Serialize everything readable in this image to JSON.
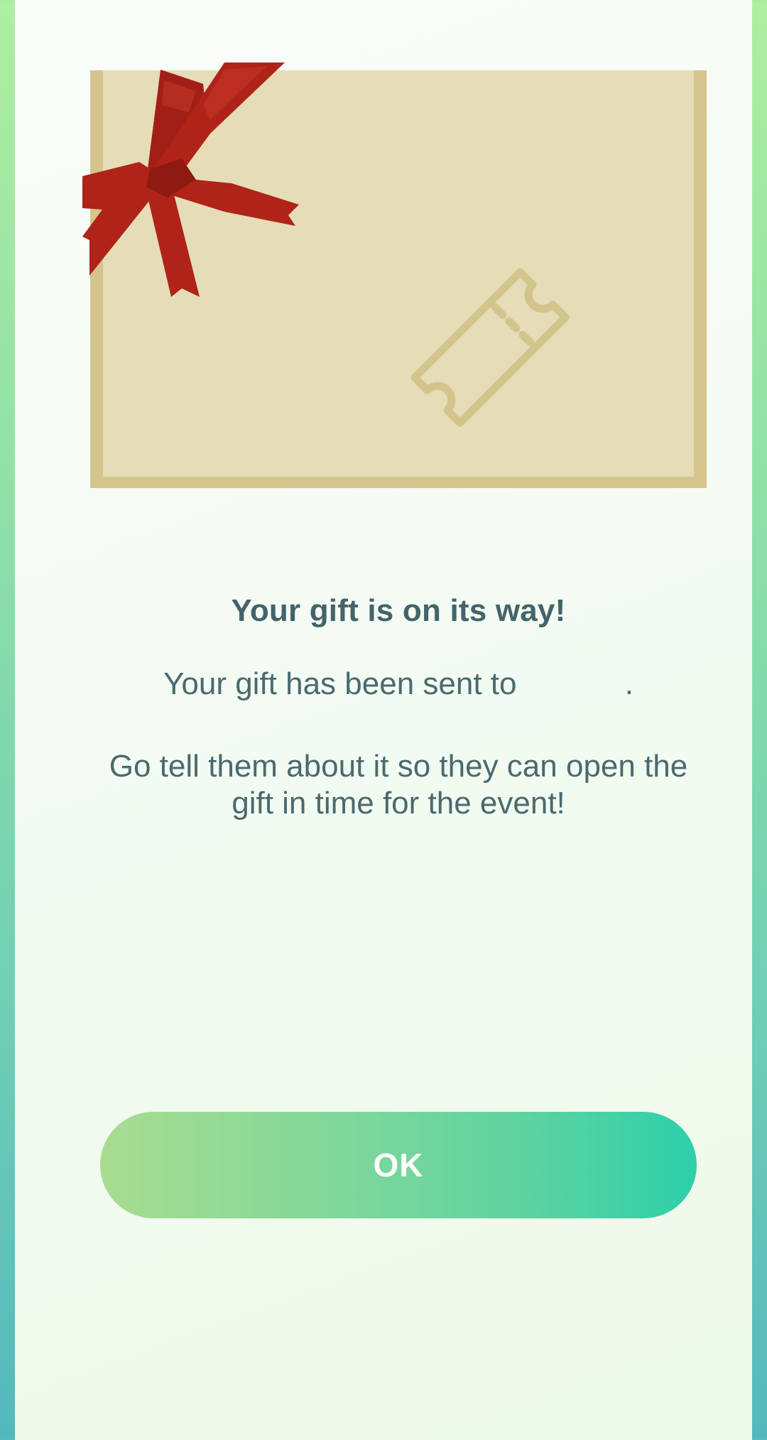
{
  "dialog": {
    "title": "Your gift is on its way!",
    "sent_prefix": "Your gift has been sent to",
    "recipient": "",
    "sent_suffix": ".",
    "message": "Go tell them about it so they can open the gift in time for the event!",
    "ok_label": "OK"
  },
  "icons": {
    "card_icon": "ticket-icon",
    "decoration": "ribbon-bow-icon"
  },
  "colors": {
    "card": "#e4ddb8",
    "card_border": "#d4c58d",
    "ribbon": "#b02318",
    "text": "#4a6a70",
    "button_start": "#a8dc90",
    "button_end": "#2ecfaa"
  }
}
